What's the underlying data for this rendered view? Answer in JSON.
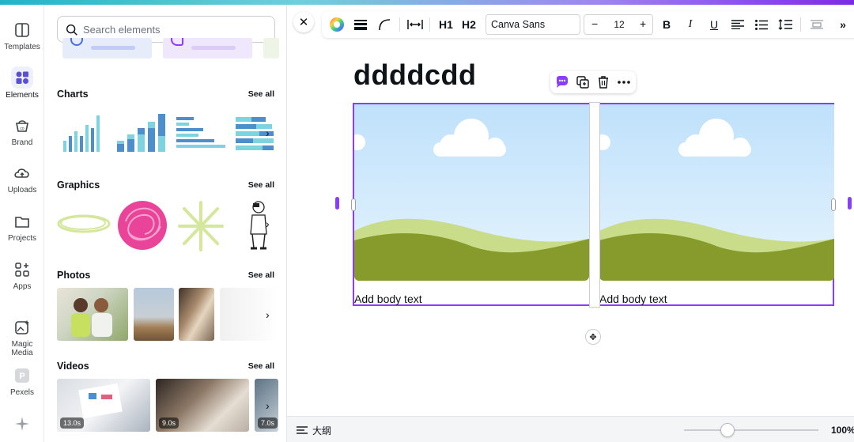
{
  "rail": {
    "items": [
      {
        "label": "Templates",
        "icon": "templates-icon"
      },
      {
        "label": "Elements",
        "icon": "elements-icon",
        "active": true
      },
      {
        "label": "Brand",
        "icon": "brand-icon"
      },
      {
        "label": "Uploads",
        "icon": "uploads-icon"
      },
      {
        "label": "Projects",
        "icon": "projects-icon"
      },
      {
        "label": "Apps",
        "icon": "apps-icon"
      },
      {
        "label": "Magic Media",
        "icon": "magic-media-icon"
      },
      {
        "label": "Pexels",
        "icon": "pexels-icon"
      }
    ]
  },
  "panel": {
    "search": {
      "placeholder": "Search elements"
    },
    "sections": [
      {
        "title": "Charts",
        "see_all": "See all"
      },
      {
        "title": "Graphics",
        "see_all": "See all"
      },
      {
        "title": "Photos",
        "see_all": "See all"
      },
      {
        "title": "Videos",
        "see_all": "See all"
      }
    ],
    "videos": [
      {
        "duration": "13.0s"
      },
      {
        "duration": "9.0s"
      },
      {
        "duration": "7.0s"
      }
    ]
  },
  "toolbar": {
    "font": "Canva Sans",
    "size": "12",
    "h1": "H1",
    "h2": "H2",
    "bold": "B",
    "italic": "I",
    "underline": "U"
  },
  "canvas": {
    "heading": "ddddcdd",
    "cells": [
      {
        "caption": "Add body text"
      },
      {
        "caption": "Add body text"
      }
    ]
  },
  "footer": {
    "outline_label": "大纲",
    "zoom": "100%"
  },
  "colors": {
    "accent": "#8b3dff",
    "sky": "#cfe8fb",
    "hill_light": "#c9dc8a",
    "hill_dark": "#869b2c"
  }
}
